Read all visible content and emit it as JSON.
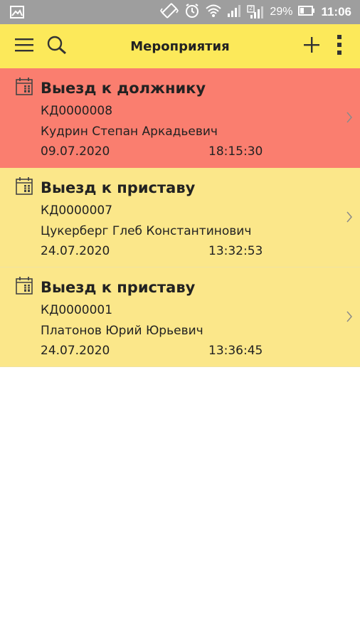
{
  "statusbar": {
    "battery": "29%",
    "time": "11:06",
    "sim2_label": "2"
  },
  "toolbar": {
    "title": "Мероприятия"
  },
  "colors": {
    "toolbar": "#fce95a",
    "overdue": "#fa7e6f",
    "normal": "#fbe78a"
  },
  "events": [
    {
      "title": "Выезд к должнику",
      "code": "КД0000008",
      "person": "Кудрин Степан Аркадьевич",
      "date": "09.07.2020",
      "time": "18:15:30",
      "status": "overdue"
    },
    {
      "title": "Выезд к приставу",
      "code": "КД0000007",
      "person": "Цукерберг Глеб Константинович",
      "date": "24.07.2020",
      "time": "13:32:53",
      "status": "normal"
    },
    {
      "title": "Выезд к приставу",
      "code": "КД0000001",
      "person": "Платонов Юрий Юрьевич",
      "date": "24.07.2020",
      "time": "13:36:45",
      "status": "normal"
    }
  ]
}
